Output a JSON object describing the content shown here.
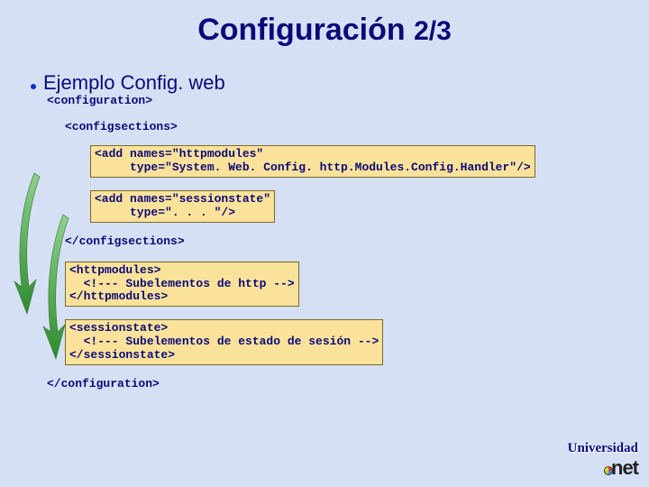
{
  "title_main": "Configuración",
  "title_sub": "2/3",
  "bullet": "Ejemplo Config. web",
  "code": {
    "cfg_open": "<configuration>",
    "csec_open": "<configsections>",
    "add1_l1": "<add names=\"httpmodules\"",
    "add1_l2": "     type=\"System. Web. Config. http.Modules.Config.Handler\"/>",
    "add2_l1": "<add names=\"sessionstate\"",
    "add2_l2": "     type=\". . . \"/>",
    "csec_close": "</configsections>",
    "http_l1": "<httpmodules>",
    "http_l2": "  <!--- Subelementos de http -->",
    "http_l3": "</httpmodules>",
    "sess_l1": "<sessionstate>",
    "sess_l2": "  <!--- Subelementos de estado de sesión -->",
    "sess_l3": "</sessionstate>",
    "cfg_close": "</configuration>"
  },
  "logo": {
    "line1": "Universidad",
    "line2": "net"
  }
}
